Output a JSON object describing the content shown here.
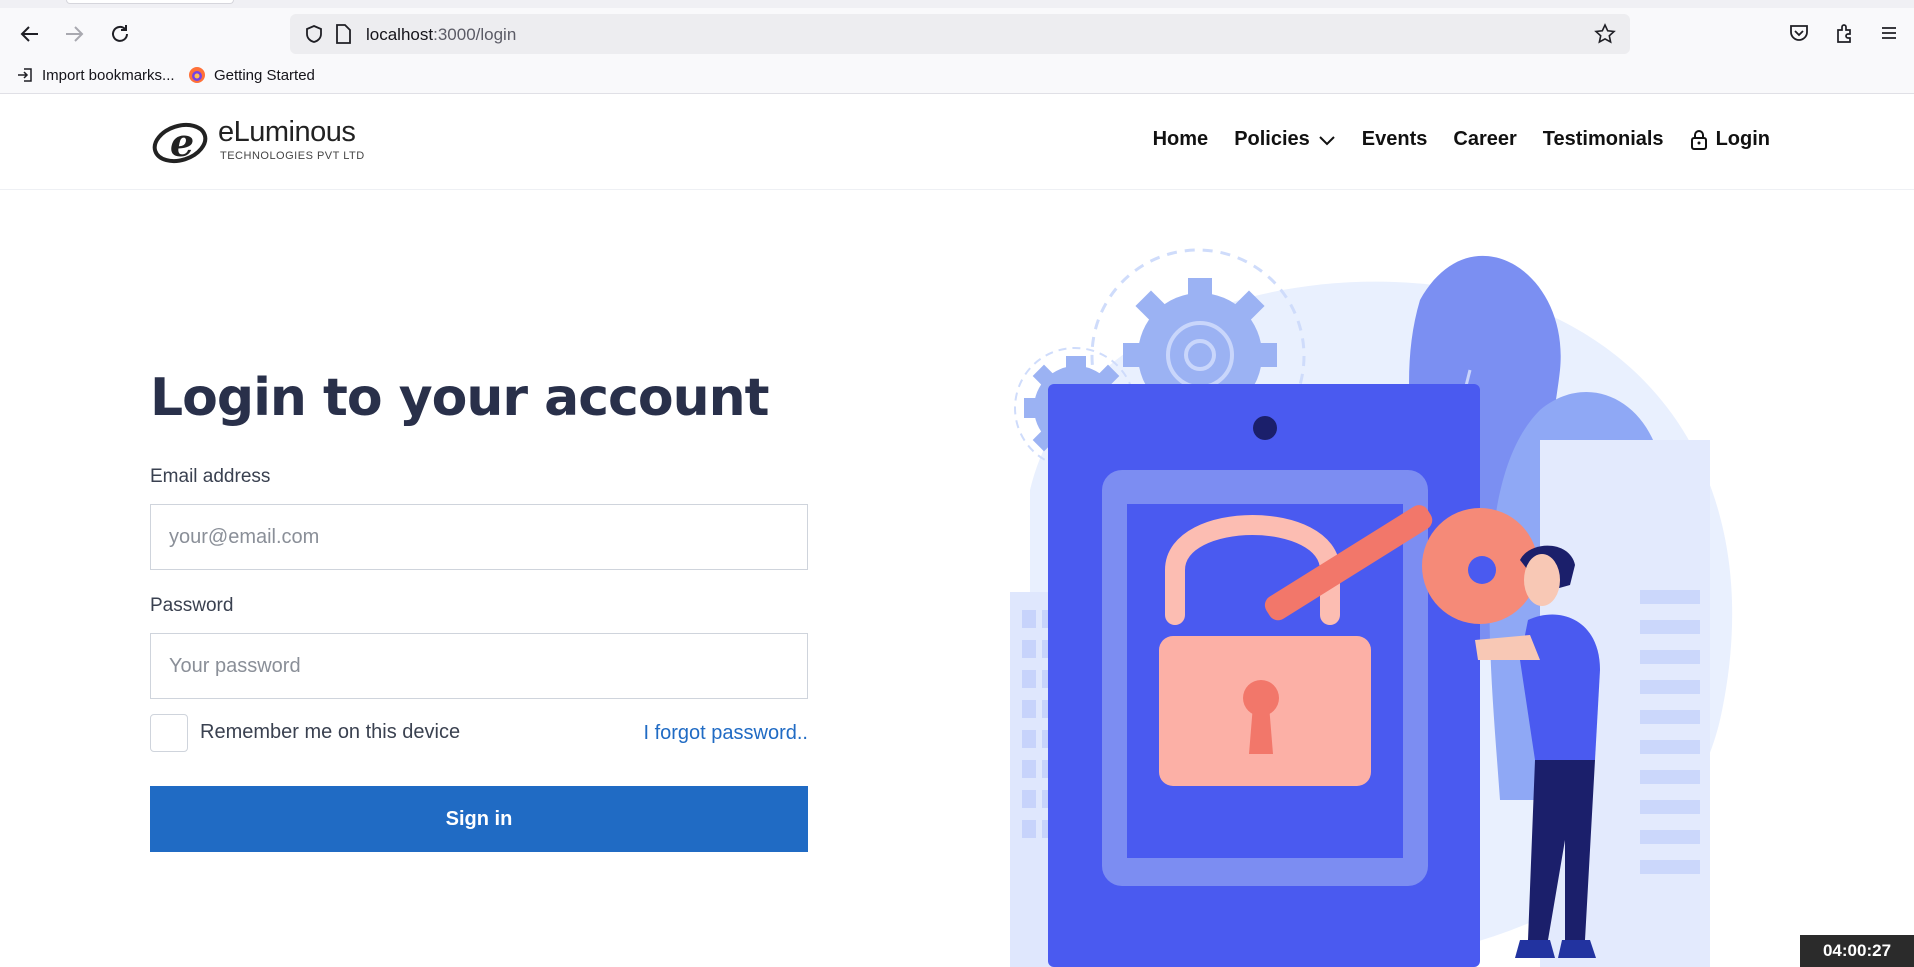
{
  "browser": {
    "url_host": "localhost",
    "url_path": ":3000/login",
    "bookmarks": [
      "Import bookmarks...",
      "Getting Started"
    ],
    "icons": [
      "back-arrow-icon",
      "forward-arrow-icon",
      "reload-icon",
      "shield-icon",
      "page-icon",
      "star-icon",
      "pocket-icon",
      "extensions-icon",
      "menu-icon"
    ]
  },
  "header": {
    "logo_word": "eLuminous",
    "logo_sub": "TECHNOLOGIES PVT LTD",
    "menu": [
      {
        "label": "Home"
      },
      {
        "label": "Policies"
      },
      {
        "label": "Events"
      },
      {
        "label": "Career"
      },
      {
        "label": "Testimonials"
      },
      {
        "label": "Login"
      }
    ]
  },
  "form": {
    "title": "Login to your account",
    "email_label": "Email address",
    "email_placeholder": "your@email.com",
    "password_label": "Password",
    "password_placeholder": "Your password",
    "remember_label": "Remember me on this device",
    "forgot_label": "I forgot password..",
    "submit_label": "Sign in"
  },
  "timer": "04:00:27",
  "colors": {
    "primary": "#206bc4",
    "title": "#29304a",
    "illustration_blue": "#4a5af0",
    "illustration_coral": "#f58a78"
  }
}
